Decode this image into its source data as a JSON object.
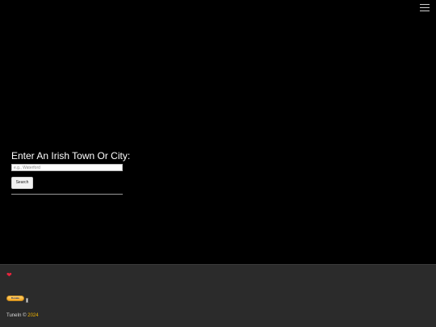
{
  "header": {
    "menu_icon": "hamburger-menu-icon"
  },
  "search": {
    "prompt": "Enter An Irish Town Or City:",
    "placeholder": "e.g., Waterford",
    "value": "",
    "button_label": "Search"
  },
  "footer": {
    "heart_icon": "heart-icon",
    "donate_label": "Donate",
    "brand": "TuneIn",
    "copyright_symbol": " © ",
    "year": "2024",
    "colors": {
      "background": "#2b2b2b",
      "year_accent": "#f0b400",
      "heart": "#e8243c"
    }
  }
}
